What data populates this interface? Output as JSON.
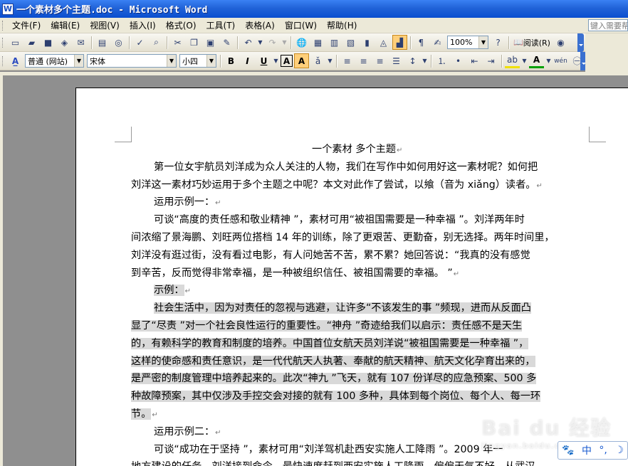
{
  "window": {
    "title": "一个素材多个主题.doc - Microsoft Word",
    "app_icon": "W"
  },
  "menubar": {
    "items": [
      "文件(F)",
      "编辑(E)",
      "视图(V)",
      "插入(I)",
      "格式(O)",
      "工具(T)",
      "表格(A)",
      "窗口(W)",
      "帮助(H)"
    ],
    "help_placeholder": "键入需要帮"
  },
  "toolbar_standard": {
    "zoom": "100%",
    "read_label": "阅读(R)"
  },
  "toolbar_formatting": {
    "style": "普通 (网站)",
    "font": "宋体",
    "size": "小四",
    "bold": "B",
    "italic": "I",
    "underline": "U",
    "char_border": "A",
    "char_shade": "A"
  },
  "document": {
    "lines": [
      {
        "text": "一个素材  多个主题",
        "indent": 254,
        "mark": "↵",
        "hl": false
      },
      {
        "text": "第一位女宇航员刘洋成为众人关注的人物，我们在写作中如何用好这一素材呢？如何把",
        "indent": 32,
        "mark": "",
        "hl": false
      },
      {
        "text": "刘洋这一素材巧妙运用于多个主题之中呢？本文对此作了尝试，以飨（音为 xiǎng）读者。",
        "indent": 0,
        "mark": "↵",
        "hl": false
      },
      {
        "text": "运用示例一：",
        "indent": 32,
        "mark": "↵",
        "hl": false
      },
      {
        "text": "可谈“高度的责任感和敬业精神 ”，素材可用“被祖国需要是一种幸福 ”。刘洋两年时",
        "indent": 32,
        "mark": "",
        "hl": false
      },
      {
        "text": "间浓缩了景海鹏、刘旺两位搭档 14 年的训练，除了更艰苦、更勤奋，别无选择。两年时间里，",
        "indent": 0,
        "mark": "",
        "hl": false
      },
      {
        "text": "刘洋没有逛过街，没有看过电影，有人问她苦不苦，累不累？她回答说：“我真的没有感觉",
        "indent": 0,
        "mark": "",
        "hl": false
      },
      {
        "text": "到辛苦，反而觉得非常幸福，是一种被组织信任、被祖国需要的幸福。 ”",
        "indent": 0,
        "mark": "↵",
        "hl": false
      },
      {
        "text": "示例：",
        "indent": 32,
        "mark": "↵",
        "hl": true
      },
      {
        "text": "社会生活中，因为对责任的忽视与逃避，让许多“不该发生的事 ”频现，进而从反面凸",
        "indent": 32,
        "mark": "",
        "hl": true
      },
      {
        "text": "显了“尽责 ”对一个社会良性运行的重要性。“神舟 ”奇迹给我们以启示：责任感不是天生",
        "indent": 0,
        "mark": "",
        "hl": true
      },
      {
        "text": "的，有赖科学的教育和制度的培养。中国首位女航天员刘洋说“被祖国需要是一种幸福 ”，",
        "indent": 0,
        "mark": "",
        "hl": true
      },
      {
        "text": "这样的使命感和责任意识，是一代代航天人执著、奉献的航天精神、航天文化孕育出来的，",
        "indent": 0,
        "mark": "",
        "hl": true
      },
      {
        "text": "是严密的制度管理中培养起来的。此次“神九 ”飞天，就有 107 份详尽的应急预案、500 多",
        "indent": 0,
        "mark": "",
        "hl": true
      },
      {
        "text": "种故障预案，其中仅涉及手控交会对接的就有 100 多种，具体到每个岗位、每个人、每一环",
        "indent": 0,
        "mark": "",
        "hl": true
      },
      {
        "text": "节。",
        "indent": 0,
        "mark": "↵",
        "hl": true
      },
      {
        "text": "运用示例二：",
        "indent": 32,
        "mark": "↵",
        "hl": false
      },
      {
        "text": "可谈“成功在于坚持 ”，素材可用“刘洋驾机赴西安实施人工降雨 ”。2009 年一",
        "indent": 32,
        "mark": "",
        "hl": false
      },
      {
        "text": "地方建设的任务，刘洋接到命令，最快速度赶到西安实施人工降雨，偏偏天气不好，从武汉",
        "indent": 0,
        "mark": "",
        "hl": false
      }
    ]
  },
  "watermark": {
    "text": "Bai du 经验",
    "sub": "jingyan.baidu.com"
  },
  "ime": {
    "mode": "中",
    "punct": "°,",
    "moon": "☽"
  },
  "colors": {
    "titlebar": "#0a4ecf",
    "chrome": "#ece9d8",
    "highlight": "#d9d9d9",
    "workspace": "#8f8f8f"
  }
}
